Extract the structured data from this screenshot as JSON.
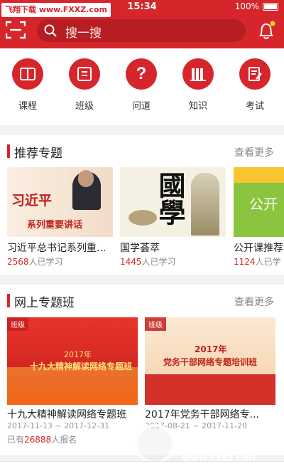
{
  "status": {
    "watermark": "飞翔下载 www.FXXZ.com",
    "time": "15:34",
    "battery": "100%"
  },
  "search": {
    "placeholder": "搜一搜"
  },
  "categories": [
    {
      "label": "课程",
      "icon": "book-icon"
    },
    {
      "label": "班级",
      "icon": "class-icon"
    },
    {
      "label": "问道",
      "icon": "question-icon"
    },
    {
      "label": "知识",
      "icon": "books-icon"
    },
    {
      "label": "考试",
      "icon": "exam-icon"
    }
  ],
  "recommended": {
    "title": "推荐专题",
    "more": "查看更多",
    "items": [
      {
        "title": "习近平总书记系列重...",
        "count": "2568",
        "suffix": "人已学习",
        "img_line1": "习近平",
        "img_line2": "系列重要讲话"
      },
      {
        "title": "国学荟萃",
        "count": "1445",
        "suffix": "人已学习",
        "img_text": "國學"
      },
      {
        "title": "公开课推荐",
        "count": "1124",
        "suffix": "人已学",
        "img_text": "公开"
      }
    ]
  },
  "online": {
    "title": "网上专题班",
    "more": "查看更多",
    "items": [
      {
        "tag": "班级",
        "img_year": "2017年",
        "img_line": "十九大精神解读网络专题班",
        "title": "十九大精神解读网络专题班",
        "date": "2017-11-13 ~ 2017-12-31",
        "prefix": "已有",
        "count": "26888",
        "suffix": "人报名"
      },
      {
        "tag": "班级",
        "img_year": "2017年",
        "img_line": "党务干部网络专题培训班",
        "title": "2017年党务干部网络专...",
        "date": "2017-08-21 ~ 2017-11-20"
      }
    ]
  },
  "bottom_watermark": {
    "text": "飞翔下载",
    "url": "WWW.FXXZ.COM"
  },
  "colors": {
    "brand": "#d6262b",
    "dark_red": "#b71d22"
  }
}
